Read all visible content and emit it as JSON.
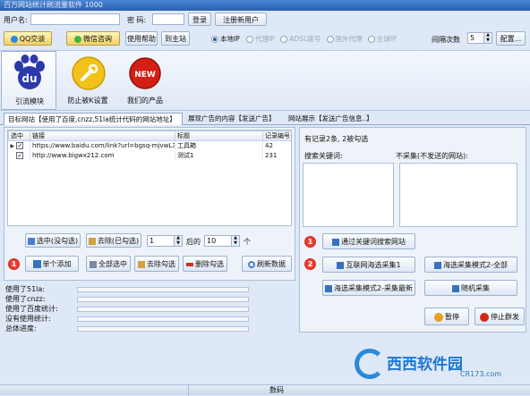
{
  "window": {
    "title": "百万网站统计刷流量软件 1000"
  },
  "login": {
    "username_label": "用户名:",
    "password_label": "密  码:",
    "login_btn": "登录",
    "register_btn": "注册新用户"
  },
  "toolbar": {
    "qq_btn": "QQ交谈",
    "wechat_btn": "微信咨询",
    "help_btn": "使用帮助",
    "site_btn": "到主站",
    "modes": [
      "本地IP",
      "代理IP",
      "ADSL拨号",
      "国外代理",
      "全球IP"
    ],
    "interval_label": "间隔次数",
    "interval_value": "5",
    "config_btn": "配置..."
  },
  "modules": [
    {
      "label": "引流模块"
    },
    {
      "label": "防止被K设置"
    },
    {
      "label": "我们的产品"
    }
  ],
  "badge": {
    "new": "NEW",
    "du": "du"
  },
  "tabs": [
    "目标网站【使用了百度,cnzz,51la统计代码的网站地址】",
    "展现广告的内容【发送广告】",
    "网站展示【发送广告信息..】"
  ],
  "table": {
    "headers": [
      "选中",
      "链接",
      "标题",
      "记录编号"
    ],
    "rows": [
      {
        "check": "✓",
        "link": "https://www.baidu.com/link?url=bgsq-mjvwL32q...",
        "title": "工具箱",
        "id": "42"
      },
      {
        "check": "✓",
        "link": "http://www.bigwx212.com",
        "title": "测试1",
        "id": "231"
      }
    ]
  },
  "selection": {
    "select_unread": "选中(没勾选)",
    "deselect_checked": "去除(已勾选)",
    "from_value": "1",
    "after_label": "后的",
    "count_value": "10",
    "unit_label": "个"
  },
  "actions": {
    "step": "1",
    "add_single": "单个添加",
    "select_all": "全部选中",
    "remove_checked": "去除勾选",
    "delete_checked": "删除勾选",
    "refresh": "刷新数据"
  },
  "stats": {
    "rows": [
      "使用了51la:",
      "使用了cnzz:",
      "使用了百度统计:",
      "没有使用统计:",
      "总体进度:"
    ]
  },
  "right": {
    "summary": "有记录2条, 2被勾选",
    "keywords_label": "搜索关键词:",
    "exclude_label": "不采集(不发送的网站):",
    "step1": "1",
    "step2": "2",
    "collect_by_keyword": "通过关键词搜索网站",
    "internet_collect_1": "互联网海选采集1",
    "haixuan_mode_2_all": "海选采集模式2-全部",
    "haixuan_mode_2_latest": "海选采集模式2-采集最新",
    "random_collect": "随机采集",
    "pause": "暂停",
    "stop_send": "停止群发"
  },
  "watermark": {
    "text": "西西软件园",
    "sub": "CR173.com"
  },
  "status": {
    "text": "数码"
  }
}
